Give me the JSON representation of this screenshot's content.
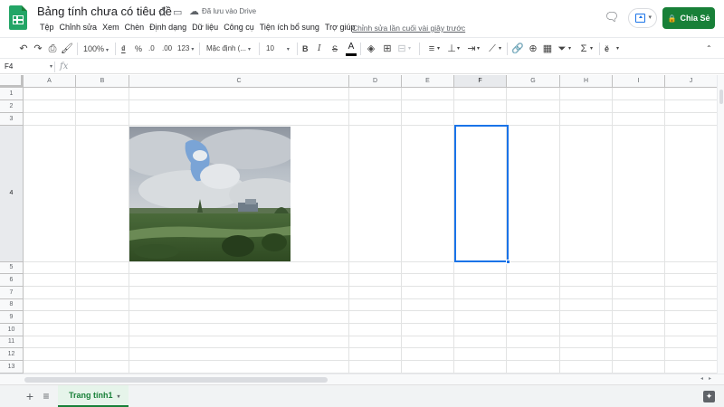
{
  "app": {
    "doc_title": "Bảng tính chưa có tiêu đề",
    "saved_status": "Đã lưu vào Drive",
    "last_edit": "Chỉnh sửa lần cuối vài giây trước",
    "share_label": "Chia Sẻ",
    "accent_color": "#188038",
    "selection_color": "#1a73e8"
  },
  "menu": [
    "Tệp",
    "Chỉnh sửa",
    "Xem",
    "Chèn",
    "Định dạng",
    "Dữ liệu",
    "Công cụ",
    "Tiện ích bổ sung",
    "Trợ giúp"
  ],
  "toolbar": {
    "zoom": "100%",
    "currency": "₫",
    "percent": "%",
    "decrease_decimal": ".0",
    "increase_decimal": ".00",
    "more_formats": "123",
    "font": "Mặc định (...",
    "font_size": "10",
    "bold": "B",
    "italic": "I",
    "strikethrough": "S",
    "text_color": "A",
    "text_rotation_glyph": "ě"
  },
  "formula_bar": {
    "cell_ref": "F4",
    "fx": "fx"
  },
  "grid": {
    "columns": [
      "A",
      "B",
      "C",
      "D",
      "E",
      "F",
      "G",
      "H",
      "I",
      "J"
    ],
    "rows": [
      "1",
      "2",
      "3",
      "4",
      "5",
      "6",
      "7",
      "8",
      "9",
      "10",
      "11",
      "12",
      "13"
    ],
    "selected_cell": "F4",
    "image_cell": "C4"
  },
  "sheets": {
    "tabs": [
      {
        "name": "Trang tính1",
        "active": true
      }
    ]
  }
}
